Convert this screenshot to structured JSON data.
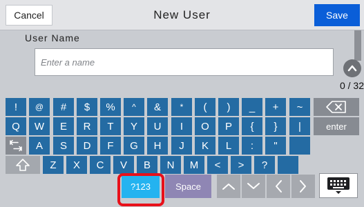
{
  "header": {
    "cancel_label": "Cancel",
    "title": "New User",
    "save_label": "Save"
  },
  "form": {
    "field_label": "User Name",
    "placeholder": "Enter a name",
    "value": "",
    "counter": "0 / 32"
  },
  "keyboard": {
    "row1": [
      "!",
      "@",
      "#",
      "$",
      "%",
      "^",
      "&",
      "*",
      "(",
      ")",
      "_",
      "+",
      "~"
    ],
    "row2": [
      "Q",
      "W",
      "E",
      "R",
      "T",
      "Y",
      "U",
      "I",
      "O",
      "P",
      "{",
      "}",
      "|"
    ],
    "row3": [
      "A",
      "S",
      "D",
      "F",
      "G",
      "H",
      "J",
      "K",
      "L",
      ":",
      "\""
    ],
    "row4": [
      "Z",
      "X",
      "C",
      "V",
      "B",
      "N",
      "M",
      "<",
      ">",
      "?"
    ],
    "enter_label": "enter",
    "mode_label": "?123",
    "space_label": "Space",
    "icons": [
      "backspace-icon",
      "tab-icon",
      "shift-icon",
      "caret-up-icon",
      "caret-down-icon",
      "caret-left-icon",
      "caret-right-icon",
      "keyboard-hide-icon"
    ]
  },
  "colors": {
    "key_blue": "#246ba3",
    "key_gray": "#878b92",
    "save_blue": "#0a5ed8",
    "mode_key": "#24b3f0",
    "highlight": "#e8101a"
  }
}
